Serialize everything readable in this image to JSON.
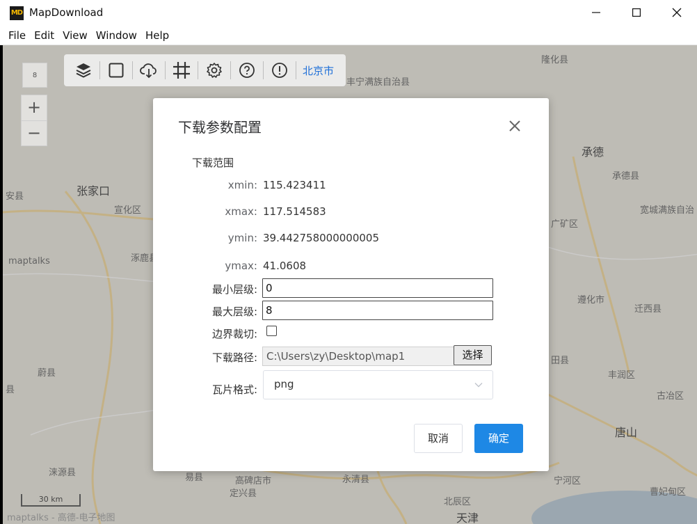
{
  "window": {
    "icon_text": "MD",
    "title": "MapDownload"
  },
  "menu": [
    "File",
    "Edit",
    "View",
    "Window",
    "Help"
  ],
  "map": {
    "zoom_level": "8",
    "zoom_in": "+",
    "zoom_out": "−",
    "city_selector": "北京市",
    "scale_label": "30 km",
    "attribution": "maptalks - 高德-电子地图",
    "labels": {
      "longhua": "隆化县",
      "fengning": "丰宁满族自治县",
      "zhangjiakou": "张家口",
      "xuanhua": "宣化区",
      "chengde": "承德",
      "chengdexian": "承德县",
      "kuancheng": "宽城满族自治",
      "shuangqiao": "广矿区",
      "zunhua": "遵化市",
      "qianxi": "迁西县",
      "fengrun": "丰润区",
      "guye": "古冶区",
      "tangshan": "唐山",
      "tianjin": "天津",
      "zhuozhou": "涿鹿县",
      "weixian": "蔚县",
      "laiyuan": "涞源县",
      "yixian": "易县",
      "gaobeidian": "高碑店市",
      "dingxing": "定兴县",
      "yongqing": "永清县",
      "beichen": "北辰区",
      "ninghe": "宁河区",
      "caofeidian": "曹妃甸区",
      "maptalks_wm": "maptalks",
      "huaian": "安县",
      "yutian": "田县",
      "xin": "县"
    }
  },
  "dialog": {
    "title": "下载参数配置",
    "section_label": "下载范围",
    "extent": [
      {
        "label": "xmin:",
        "value": "115.423411"
      },
      {
        "label": "xmax:",
        "value": "117.514583"
      },
      {
        "label": "ymin:",
        "value": "39.442758000000005"
      },
      {
        "label": "ymax:",
        "value": "41.0608"
      }
    ],
    "min_zoom_label": "最小层级:",
    "min_zoom_value": "0",
    "max_zoom_label": "最大层级:",
    "max_zoom_value": "8",
    "clip_label": "边界裁切:",
    "clip_checked": false,
    "path_label": "下载路径:",
    "path_value": "C:\\Users\\zy\\Desktop\\map1",
    "choose_button": "选择",
    "format_label": "瓦片格式:",
    "format_value": "png",
    "cancel_button": "取消",
    "ok_button": "确定"
  },
  "colors": {
    "primary": "#1e88e5",
    "city_link": "#1e6fd8"
  }
}
